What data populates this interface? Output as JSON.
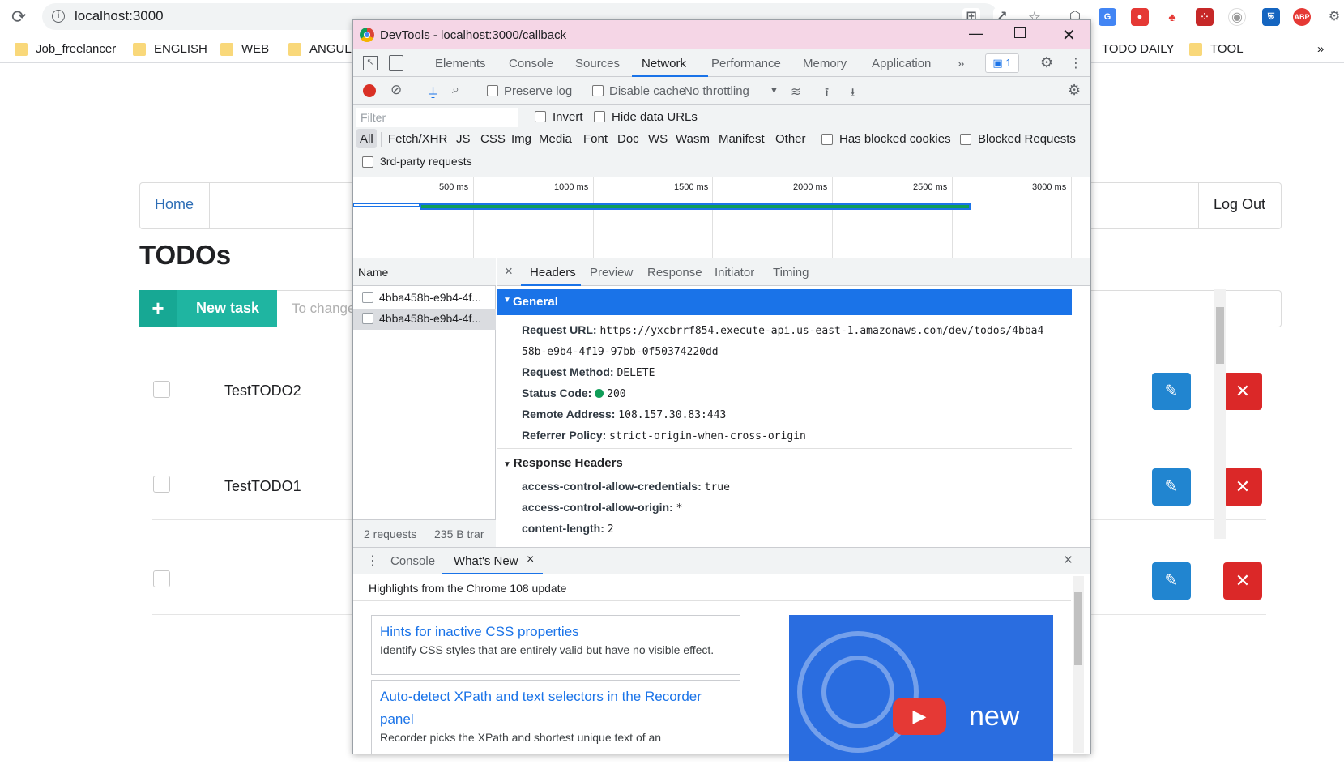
{
  "browser": {
    "url": "localhost:3000",
    "bookmarks": [
      "Job_freelancer",
      "ENGLISH",
      "WEB",
      "ANGULA",
      "TODO DAILY",
      "TOOL"
    ],
    "bookmarks_more": "»"
  },
  "page": {
    "nav": {
      "home": "Home",
      "logout": "Log Out"
    },
    "title": "TODOs",
    "new_task_icon": "+",
    "new_task_label": "New task",
    "task_placeholder": "To change",
    "todos": [
      {
        "name": "TestTODO2"
      },
      {
        "name": "TestTODO1"
      },
      {
        "name": ""
      }
    ]
  },
  "devtools": {
    "window_title": "DevTools - localhost:3000/callback",
    "tabs": [
      "Elements",
      "Console",
      "Sources",
      "Network",
      "Performance",
      "Memory",
      "Application"
    ],
    "more_tabs": "»",
    "active_tab": "Network",
    "issues_count": "1",
    "toolbar": {
      "preserve_log": "Preserve log",
      "disable_cache": "Disable cache",
      "throttling": "No throttling"
    },
    "filter": {
      "placeholder": "Filter",
      "invert": "Invert",
      "hide_data_urls": "Hide data URLs",
      "types": [
        "All",
        "Fetch/XHR",
        "JS",
        "CSS",
        "Img",
        "Media",
        "Font",
        "Doc",
        "WS",
        "Wasm",
        "Manifest",
        "Other"
      ],
      "has_blocked_cookies": "Has blocked cookies",
      "blocked_requests": "Blocked Requests",
      "third_party": "3rd-party requests"
    },
    "timeline": {
      "ticks": [
        "500 ms",
        "1000 ms",
        "1500 ms",
        "2000 ms",
        "2500 ms",
        "3000 ms"
      ]
    },
    "requests": {
      "header": "Name",
      "items": [
        "4bba458b-e9b4-4f...",
        "4bba458b-e9b4-4f..."
      ],
      "footer_count": "2 requests",
      "footer_size": "235 B trar"
    },
    "details": {
      "close": "×",
      "tabs": [
        "Headers",
        "Preview",
        "Response",
        "Initiator",
        "Timing"
      ],
      "general_title": "General",
      "general": {
        "request_url_label": "Request URL:",
        "request_url_1": "https://yxcbrrf854.execute-api.us-east-1.amazonaws.com/dev/todos/4bba4",
        "request_url_2": "58b-e9b4-4f19-97bb-0f50374220dd",
        "method_label": "Request Method:",
        "method": "DELETE",
        "status_label": "Status Code:",
        "status": "200",
        "status_color": "#0f9d58",
        "remote_label": "Remote Address:",
        "remote": "108.157.30.83:443",
        "referrer_label": "Referrer Policy:",
        "referrer": "strict-origin-when-cross-origin"
      },
      "response_headers_title": "Response Headers",
      "response_headers": [
        {
          "k": "access-control-allow-credentials:",
          "v": "true"
        },
        {
          "k": "access-control-allow-origin:",
          "v": "*"
        },
        {
          "k": "content-length:",
          "v": "2"
        }
      ]
    },
    "drawer": {
      "tabs": [
        "Console",
        "What's New"
      ],
      "close_tab": "×",
      "close": "×",
      "highlights": "Highlights from the Chrome 108 update",
      "cards": [
        {
          "title": "Hints for inactive CSS properties",
          "desc": "Identify CSS styles that are entirely valid but have no visible effect."
        },
        {
          "title": "Auto-detect XPath and text selectors in the Recorder panel",
          "desc": "Recorder picks the XPath and shortest unique text of an"
        }
      ],
      "video_text": "new"
    }
  },
  "colors": {
    "accent": "#1a73e8",
    "teal": "#1fb5a1",
    "edit": "#2185d0",
    "delete": "#db2828"
  }
}
